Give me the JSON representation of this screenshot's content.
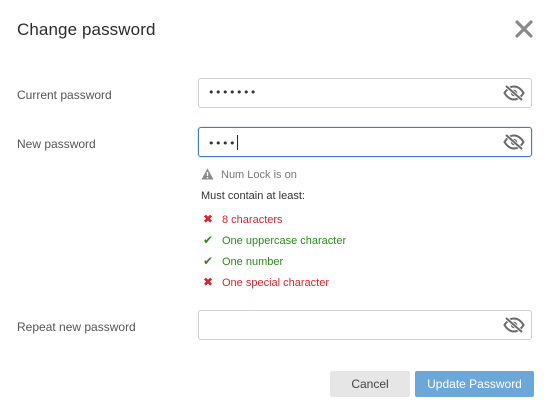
{
  "dialog": {
    "title": "Change password",
    "close_icon": "close-icon"
  },
  "fields": {
    "current": {
      "label": "Current password",
      "value": "•••••••",
      "visibility_icon": "eye-slash-icon"
    },
    "new": {
      "label": "New password",
      "value": "••••",
      "visibility_icon": "eye-slash-icon"
    },
    "repeat": {
      "label": "Repeat new password",
      "value": "",
      "visibility_icon": "eye-slash-icon"
    }
  },
  "hints": {
    "numlock_text": "Num Lock is on",
    "numlock_icon": "warning-icon",
    "must_contain": "Must contain at least:",
    "requirements": [
      {
        "text": "8 characters",
        "met": false,
        "mark": "✖"
      },
      {
        "text": "One uppercase character",
        "met": true,
        "mark": "✔"
      },
      {
        "text": "One number",
        "met": true,
        "mark": "✔"
      },
      {
        "text": "One special character",
        "met": false,
        "mark": "✖"
      }
    ]
  },
  "buttons": {
    "cancel": "Cancel",
    "update": "Update Password"
  },
  "colors": {
    "fail": "#d9232a",
    "pass": "#2a8a1a",
    "primary": "#6ba7d8",
    "focus_border": "#3d7cc9"
  }
}
